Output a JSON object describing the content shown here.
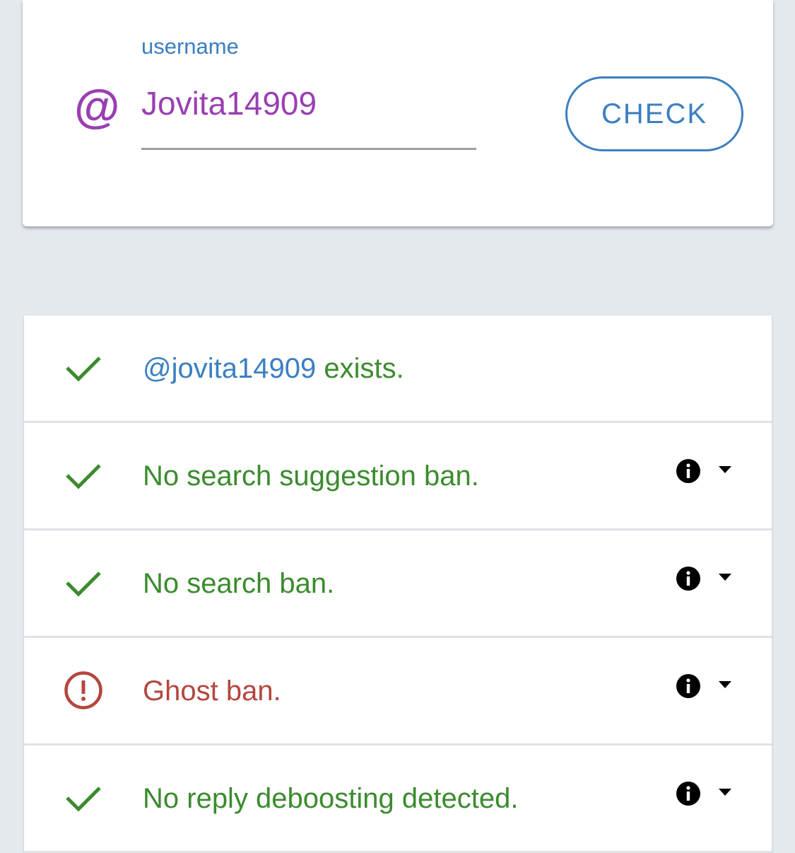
{
  "search": {
    "label": "username",
    "value": "Jovita14909",
    "prefix_icon": "at-sign-icon",
    "prefix_char": "@",
    "button_label": "CHECK"
  },
  "colors": {
    "accent_blue": "#3b7fc1",
    "purple": "#9a3fb2",
    "success_green": "#3b8b2e",
    "error_red": "#b4463e"
  },
  "results": [
    {
      "status": "ok",
      "icon": "checkmark-icon",
      "handle": "@jovita14909",
      "text": " exists.",
      "has_details": false
    },
    {
      "status": "ok",
      "icon": "checkmark-icon",
      "text": "No search suggestion ban.",
      "has_details": true
    },
    {
      "status": "ok",
      "icon": "checkmark-icon",
      "text": "No search ban.",
      "has_details": true
    },
    {
      "status": "error",
      "icon": "alert-circle-icon",
      "text": "Ghost ban.",
      "has_details": true
    },
    {
      "status": "ok",
      "icon": "checkmark-icon",
      "text": "No reply deboosting detected.",
      "has_details": true
    }
  ]
}
